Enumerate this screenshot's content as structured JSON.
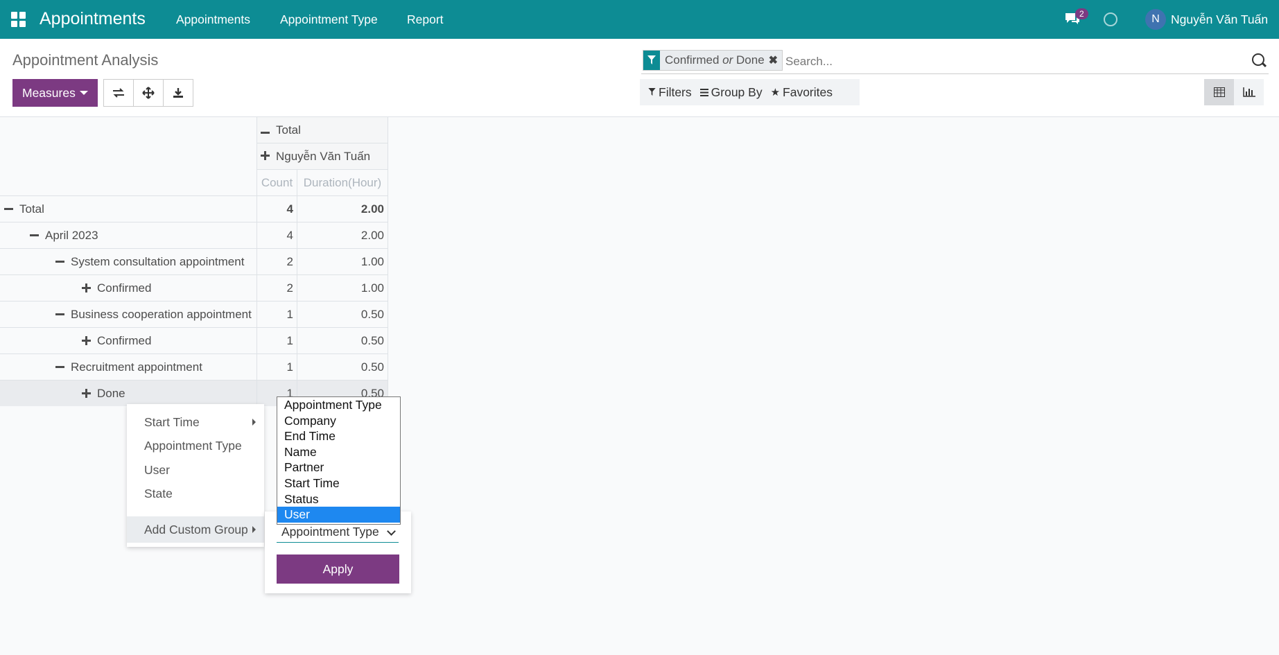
{
  "topbar": {
    "app_title": "Appointments",
    "menu": [
      "Appointments",
      "Appointment Type",
      "Report"
    ],
    "chat_badge": "2",
    "avatar_initial": "N",
    "user_name": "Nguyễn Văn Tuấn",
    "bg_color": "#0d8c94"
  },
  "control": {
    "title": "Appointment Analysis",
    "measures_label": "Measures",
    "tools": [
      "swap-axes-icon",
      "expand-all-icon",
      "download-icon"
    ]
  },
  "search": {
    "facet_a": "Confirmed",
    "facet_or": "or",
    "facet_b": "Done",
    "placeholder": "Search..."
  },
  "filterbar": {
    "filters": "Filters",
    "group_by": "Group By",
    "favorites": "Favorites"
  },
  "pivot": {
    "col_total": "Total",
    "col_user": "Nguyễn Văn Tuấn",
    "measure_count": "Count",
    "measure_duration": "Duration(Hour)",
    "rows": [
      {
        "label": "Total",
        "count": "4",
        "duration": "2.00"
      },
      {
        "label": "April 2023",
        "count": "4",
        "duration": "2.00"
      },
      {
        "label": "System consultation appointment",
        "count": "2",
        "duration": "1.00"
      },
      {
        "label": "Confirmed",
        "count": "2",
        "duration": "1.00"
      },
      {
        "label": "Business cooperation appointment",
        "count": "1",
        "duration": "0.50"
      },
      {
        "label": "Confirmed",
        "count": "1",
        "duration": "0.50"
      },
      {
        "label": "Recruitment appointment",
        "count": "1",
        "duration": "0.50"
      },
      {
        "label": "Done",
        "count": "1",
        "duration": "0.50"
      }
    ]
  },
  "groupby_menu": {
    "items": [
      "Start Time",
      "Appointment Type",
      "User",
      "State"
    ],
    "custom_group": "Add Custom Group"
  },
  "custom_group": {
    "selected": "Appointment Type",
    "apply": "Apply",
    "options": [
      "Appointment Type",
      "Company",
      "End Time",
      "Name",
      "Partner",
      "Start Time",
      "Status",
      "User"
    ],
    "highlighted": "User"
  }
}
